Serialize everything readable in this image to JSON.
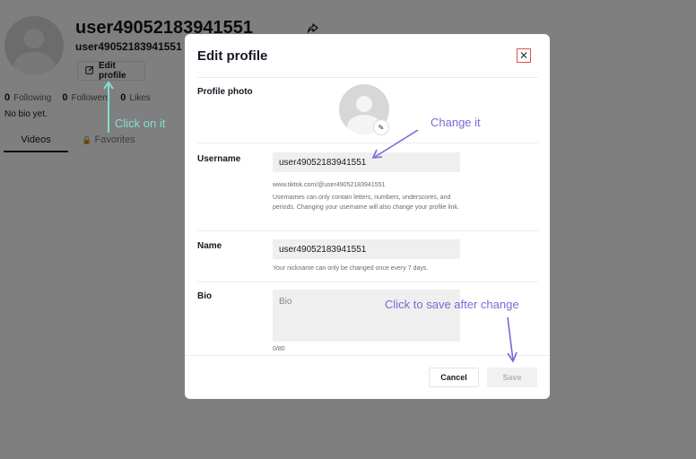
{
  "profile": {
    "username": "user49052183941551",
    "nickname": "user49052183941551",
    "edit_button_label": "Edit profile",
    "stats": [
      {
        "count": "0",
        "label": "Following"
      },
      {
        "count": "0",
        "label": "Followers"
      },
      {
        "count": "0",
        "label": "Likes"
      }
    ],
    "bio": "No bio yet.",
    "tabs": [
      {
        "label": "Videos"
      },
      {
        "label": "Favorites"
      }
    ]
  },
  "modal": {
    "title": "Edit profile",
    "profile_photo_label": "Profile photo",
    "username_label": "Username",
    "username_value": "user49052183941551",
    "username_url": "www.tiktok.com/@user49052183941551",
    "username_help": "Usernames can only contain letters, numbers, underscores, and periods. Changing your username will also change your profile link.",
    "name_label": "Name",
    "name_value": "user49052183941551",
    "name_help": "Your nickname can only be changed once every 7 days.",
    "bio_label": "Bio",
    "bio_placeholder": "Bio",
    "bio_count": "0/80",
    "cancel_label": "Cancel",
    "save_label": "Save"
  },
  "annotations": {
    "click_on_it": "Click on it",
    "change_it": "Change it",
    "click_to_save": "Click to save after change",
    "color": "#7b68d6",
    "teal": "#7fe0cf"
  },
  "icons": {
    "share": "share-icon",
    "edit": "edit-icon",
    "lock": "lock-icon",
    "close": "close-icon",
    "pencil": "pencil-icon"
  }
}
